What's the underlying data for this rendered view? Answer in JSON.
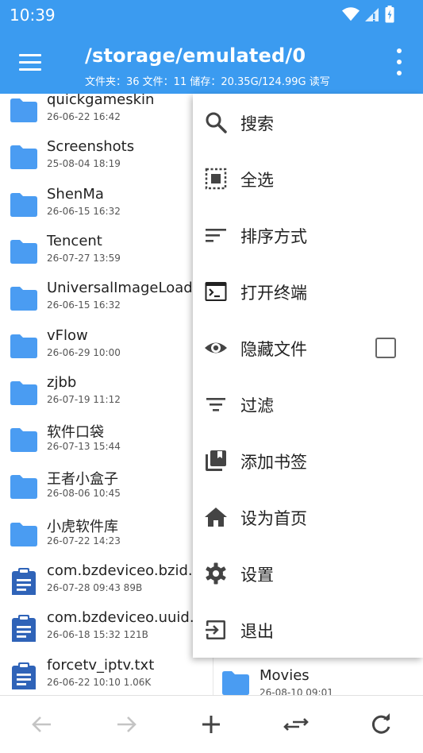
{
  "status": {
    "time": "10:39"
  },
  "header": {
    "path": "/storage/emulated/0",
    "info": "文件夹：36 文件：11  储存：20.35G/124.99G    读写"
  },
  "files": [
    {
      "name": "quickgameskin",
      "meta": "26-06-22 16:42",
      "type": "folder"
    },
    {
      "name": "Screenshots",
      "meta": "25-08-04 18:19",
      "type": "folder"
    },
    {
      "name": "ShenMa",
      "meta": "26-06-15 16:32",
      "type": "folder"
    },
    {
      "name": "Tencent",
      "meta": "26-07-27 13:59",
      "type": "folder"
    },
    {
      "name": "UniversalImageLoade",
      "meta": "26-06-15 16:32",
      "type": "folder"
    },
    {
      "name": "vFlow",
      "meta": "26-06-29 10:00",
      "type": "folder"
    },
    {
      "name": "zjbb",
      "meta": "26-07-19 11:12",
      "type": "folder"
    },
    {
      "name": "软件口袋",
      "meta": "26-07-13 15:44",
      "type": "folder"
    },
    {
      "name": "王者小盒子",
      "meta": "26-08-06 10:45",
      "type": "folder"
    },
    {
      "name": "小虎软件库",
      "meta": "26-07-22 14:23",
      "type": "folder"
    },
    {
      "name": "com.bzdeviceo.bzid.tx",
      "meta": "26-07-28 09:43  89B",
      "type": "file"
    },
    {
      "name": "com.bzdeviceo.uuid.tx",
      "meta": "26-06-18 15:32  121B",
      "type": "file"
    },
    {
      "name": "forcetv_iptv.txt",
      "meta": "26-06-22 10:10  1.06K",
      "type": "file"
    }
  ],
  "second_pane": {
    "name": "Movies",
    "meta": "26-08-10 09:01"
  },
  "menu": {
    "search": "搜索",
    "select_all": "全选",
    "sort": "排序方式",
    "terminal": "打开终端",
    "hidden_files": "隐藏文件",
    "filter": "过滤",
    "add_bookmark": "添加书签",
    "set_home": "设为首页",
    "settings": "设置",
    "exit": "退出"
  },
  "colors": {
    "accent": "#3b9bf0",
    "folder": "#4a9cf2",
    "file": "#2f63b8"
  }
}
